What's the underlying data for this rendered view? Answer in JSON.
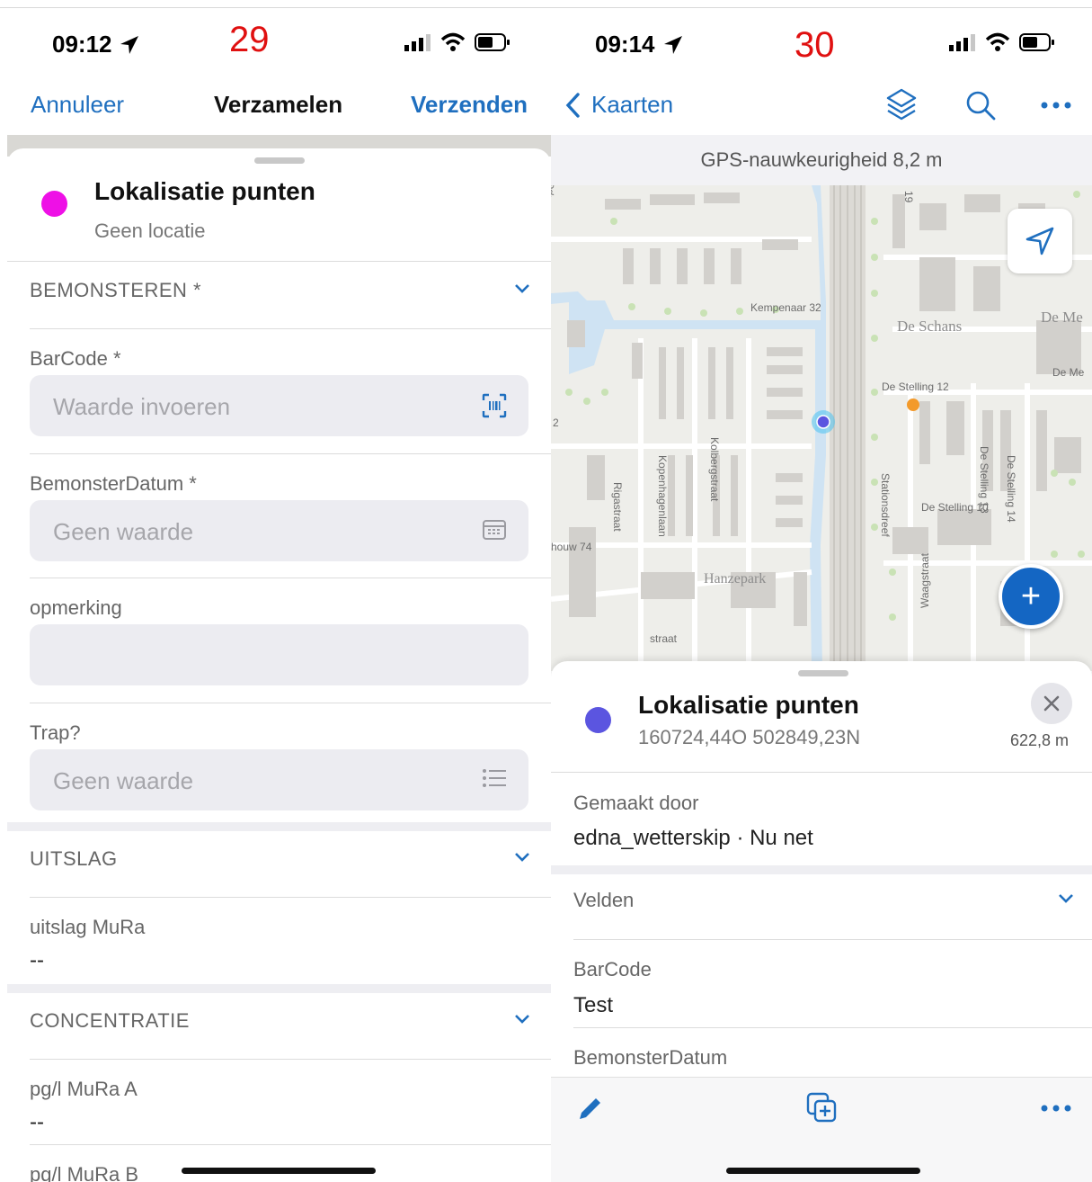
{
  "left": {
    "status": {
      "time": "09:12",
      "shot_number": "29"
    },
    "nav": {
      "cancel": "Annuleer",
      "title": "Verzamelen",
      "send": "Verzenden"
    },
    "header": {
      "title": "Lokalisatie punten",
      "subtitle": "Geen locatie",
      "dot_color": "#ee10e6"
    },
    "sections": [
      {
        "label": "BEMONSTEREN *"
      },
      {
        "label": "UITSLAG"
      },
      {
        "label": "CONCENTRATIE"
      }
    ],
    "fields": {
      "barcode": {
        "label": "BarCode *",
        "placeholder": "Waarde invoeren"
      },
      "datum": {
        "label": "BemonsterDatum *",
        "placeholder": "Geen waarde"
      },
      "opmerking": {
        "label": "opmerking",
        "placeholder": ""
      },
      "trap": {
        "label": "Trap?",
        "placeholder": "Geen waarde"
      },
      "uitslag": {
        "label": "uitslag MuRa",
        "value": "--"
      },
      "murA": {
        "label": "pg/l MuRa A",
        "value": "--"
      },
      "murB": {
        "label": "pg/l MuRa B"
      }
    },
    "accent": "#1f6fbf"
  },
  "right": {
    "status": {
      "time": "09:14",
      "shot_number": "30"
    },
    "nav": {
      "back": "Kaarten"
    },
    "gps": "GPS-nauwkeurigheid 8,2 m",
    "map_labels": {
      "kempenaar": "Kempenaar",
      "kempenaar32": "Kempenaar 32",
      "deschans": "De Schans",
      "deme": "De Me",
      "deme2": "De Me",
      "destelling12": "De Stelling 12",
      "destelling10": "De Stelling 10",
      "destelling13": "De Stelling 13",
      "destelling14": "De Stelling 14",
      "hanzepark": "Hanzepark",
      "rigastraat": "Rigastraat",
      "kopenhagenlaan": "Kopenhagenlaan",
      "kolbergstraat": "Kolbergstraat",
      "stationsdreef": "Stationsdreef",
      "waagstraat": "Waagstraat",
      "houw": "houw 74",
      "straat": "straat",
      "nineteen": "19",
      "two": "2"
    },
    "feature": {
      "title": "Lokalisatie punten",
      "coords": "160724,44O 502849,23N",
      "distance": "622,8 m",
      "dot_color": "#5b55e0"
    },
    "created": {
      "label": "Gemaakt door",
      "value": "edna_wetterskip · Nu net"
    },
    "velden": "Velden",
    "fields": {
      "barcode": {
        "label": "BarCode",
        "value": "Test"
      },
      "datum": {
        "label": "BemonsterDatum"
      }
    },
    "accent": "#1466c3"
  }
}
